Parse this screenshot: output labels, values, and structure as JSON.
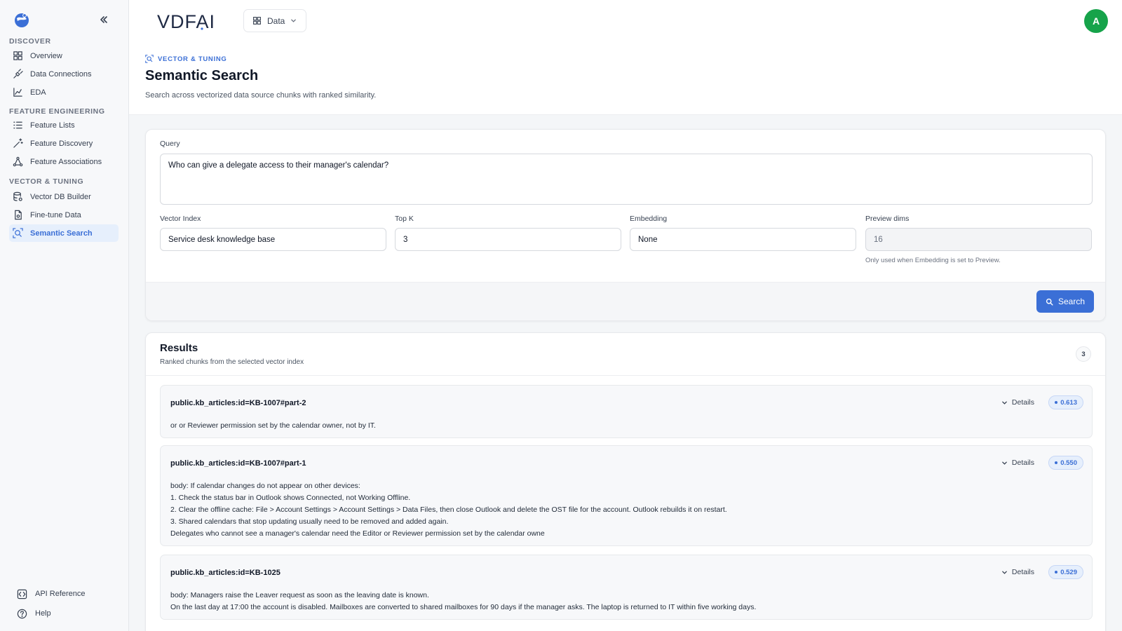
{
  "sidebar": {
    "sections": [
      {
        "label": "DISCOVER",
        "items": [
          {
            "label": "Overview",
            "icon": "grid-icon"
          },
          {
            "label": "Data Connections",
            "icon": "plug-icon"
          },
          {
            "label": "EDA",
            "icon": "chart-icon"
          }
        ]
      },
      {
        "label": "FEATURE ENGINEERING",
        "items": [
          {
            "label": "Feature Lists",
            "icon": "list-icon"
          },
          {
            "label": "Feature Discovery",
            "icon": "wand-icon"
          },
          {
            "label": "Feature Associations",
            "icon": "network-icon"
          }
        ]
      },
      {
        "label": "VECTOR & TUNING",
        "items": [
          {
            "label": "Vector DB Builder",
            "icon": "database-icon"
          },
          {
            "label": "Fine-tune Data",
            "icon": "file-icon"
          },
          {
            "label": "Semantic Search",
            "icon": "search-scan-icon",
            "active": true
          }
        ]
      }
    ],
    "bottom": [
      {
        "label": "API Reference",
        "icon": "api-icon"
      },
      {
        "label": "Help",
        "icon": "help-icon"
      }
    ]
  },
  "header": {
    "brand": "VDFAI",
    "dropdown_label": "Data",
    "avatar_initial": "A"
  },
  "page": {
    "eyebrow": "VECTOR & TUNING",
    "title": "Semantic Search",
    "subtitle": "Search across vectorized data source chunks with ranked similarity."
  },
  "form": {
    "query_label": "Query",
    "query_value": "Who can give a delegate access to their manager's calendar?",
    "vector_index_label": "Vector Index",
    "vector_index_value": "Service desk knowledge base",
    "topk_label": "Top K",
    "topk_value": "3",
    "embedding_label": "Embedding",
    "embedding_value": "None",
    "preview_label": "Preview dims",
    "preview_value": "16",
    "preview_hint": "Only used when Embedding is set to Preview.",
    "search_label": "Search"
  },
  "results": {
    "title": "Results",
    "subtitle": "Ranked chunks from the selected vector index",
    "count": "3",
    "details_label": "Details",
    "items": [
      {
        "id": "public.kb_articles:id=KB-1007#part-2",
        "score": "0.613",
        "lines": [
          "or or Reviewer permission set by the calendar owner, not by IT."
        ]
      },
      {
        "id": "public.kb_articles:id=KB-1007#part-1",
        "score": "0.550",
        "lines": [
          "body: If calendar changes do not appear on other devices:",
          "1. Check the status bar in Outlook shows Connected, not Working Offline.",
          "2. Clear the offline cache: File > Account Settings > Account Settings > Data Files, then close Outlook and delete the OST file for the account. Outlook rebuilds it on restart.",
          "3. Shared calendars that stop updating usually need to be removed and added again.",
          "Delegates who cannot see a manager's calendar need the Editor or Reviewer permission set by the calendar owne"
        ]
      },
      {
        "id": "public.kb_articles:id=KB-1025",
        "score": "0.529",
        "lines": [
          "body: Managers raise the Leaver request as soon as the leaving date is known.",
          "On the last day at 17:00 the account is disabled. Mailboxes are converted to shared mailboxes for 90 days if the manager asks. The laptop is returned to IT within five working days."
        ]
      }
    ]
  },
  "colors": {
    "accent": "#3b6fd6",
    "avatar": "#16a34a",
    "active_bg": "#e6effc"
  }
}
